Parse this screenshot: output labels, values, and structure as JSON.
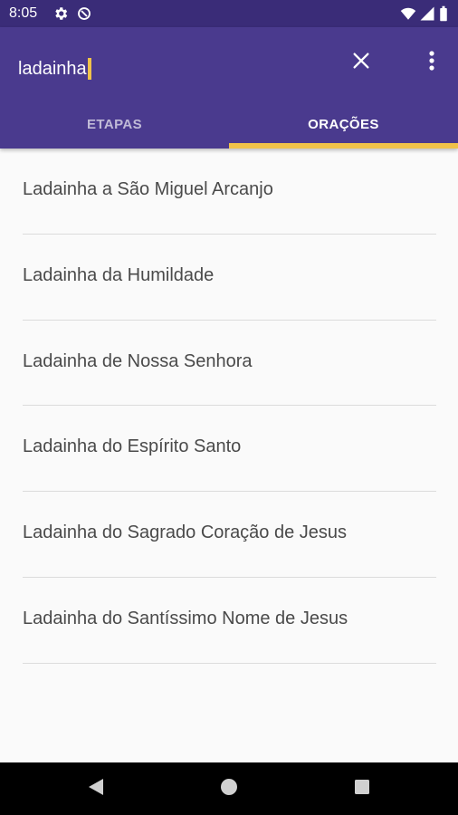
{
  "status_bar": {
    "time": "8:05",
    "icons": [
      "settings-icon",
      "data-saver-icon",
      "wifi-icon",
      "signal-icon",
      "battery-icon"
    ]
  },
  "search": {
    "query": "ladainha",
    "clear_icon": "close-icon",
    "menu_icon": "more-vert-icon"
  },
  "tabs": [
    {
      "label": "ETAPAS",
      "active": false
    },
    {
      "label": "ORAÇÕES",
      "active": true
    }
  ],
  "results": [
    {
      "label": "Ladainha a São Miguel Arcanjo"
    },
    {
      "label": "Ladainha da Humildade"
    },
    {
      "label": "Ladainha de Nossa Senhora"
    },
    {
      "label": "Ladainha do Espírito Santo"
    },
    {
      "label": "Ladainha do Sagrado Coração de Jesus"
    },
    {
      "label": "Ladainha do Santíssimo Nome de Jesus"
    }
  ],
  "nav_bar": {
    "icons": [
      "back-icon",
      "home-icon",
      "recents-icon"
    ]
  },
  "colors": {
    "status_bar": "#3a2c78",
    "app_bar": "#4a3a8e",
    "accent": "#f0c24a",
    "background": "#fafafa",
    "text": "#4a4a4a"
  }
}
